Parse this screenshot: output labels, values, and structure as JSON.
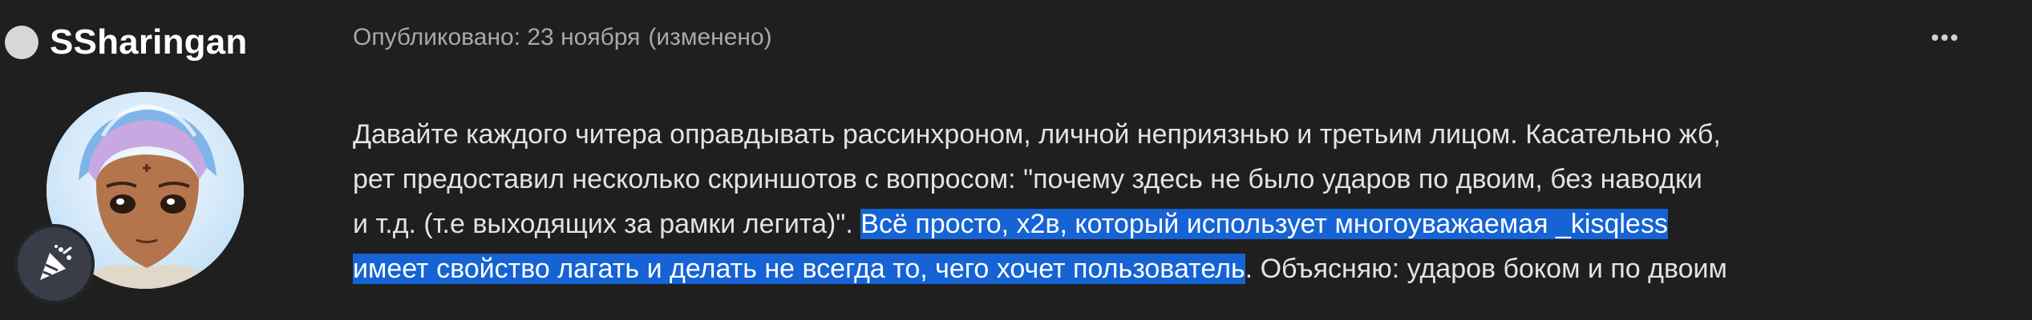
{
  "post": {
    "author": "SSharingan",
    "meta_published": "Опубликовано: 23 ноября",
    "meta_edited": "(изменено)",
    "more_icon": "more-dots-icon",
    "avatar": "user-avatar-anime-portrait",
    "badge_icon": "party-popper-icon",
    "lines": [
      [
        "Давайте каждого читера оправдывать рассинхроном, личной неприязнью и третьим лицом. Касательно жб,"
      ],
      [
        "рет предоставил несколько скриншотов с вопросом: \"почему здесь не было ударов по двоим, без наводки"
      ],
      [
        "и т.д. (т.е выходящих за рамки легита)\". ",
        "Всё просто, х2в, который использует многоуважаемая _kisqless"
      ],
      [
        "имеет свойство лагать и делать не всегда то, чего хочет пользователь",
        ". Объясняю: ударов боком и по двоим"
      ]
    ],
    "colors": {
      "background": "#1f1f1f",
      "selection": "#1563d4",
      "meta": "#a9a9a9"
    }
  }
}
